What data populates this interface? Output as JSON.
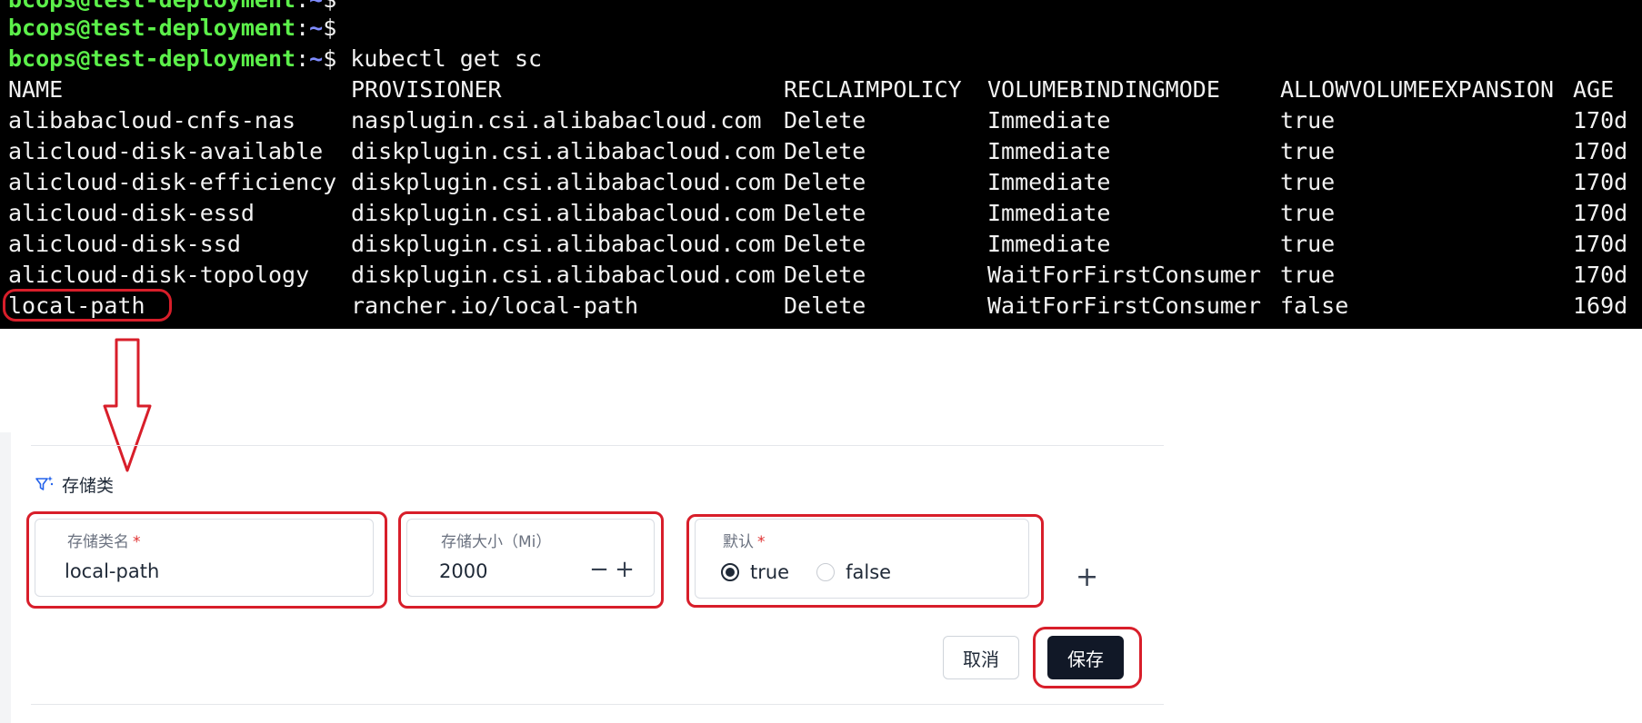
{
  "terminal": {
    "prompt": {
      "user_host": "bcops@test-deployment",
      "path": "~",
      "dollar": "$"
    },
    "command": "kubectl get sc",
    "headers": [
      "NAME",
      "PROVISIONER",
      "RECLAIMPOLICY",
      "VOLUMEBINDINGMODE",
      "ALLOWVOLUMEEXPANSION",
      "AGE"
    ],
    "rows": [
      [
        "alibabacloud-cnfs-nas",
        "nasplugin.csi.alibabacloud.com",
        "Delete",
        "Immediate",
        "true",
        "170d"
      ],
      [
        "alicloud-disk-available",
        "diskplugin.csi.alibabacloud.com",
        "Delete",
        "Immediate",
        "true",
        "170d"
      ],
      [
        "alicloud-disk-efficiency",
        "diskplugin.csi.alibabacloud.com",
        "Delete",
        "Immediate",
        "true",
        "170d"
      ],
      [
        "alicloud-disk-essd",
        "diskplugin.csi.alibabacloud.com",
        "Delete",
        "Immediate",
        "true",
        "170d"
      ],
      [
        "alicloud-disk-ssd",
        "diskplugin.csi.alibabacloud.com",
        "Delete",
        "Immediate",
        "true",
        "170d"
      ],
      [
        "alicloud-disk-topology",
        "diskplugin.csi.alibabacloud.com",
        "Delete",
        "WaitForFirstConsumer",
        "true",
        "170d"
      ],
      [
        "local-path",
        "rancher.io/local-path",
        "Delete",
        "WaitForFirstConsumer",
        "false",
        "169d"
      ]
    ]
  },
  "form": {
    "section_title": "存储类",
    "section_icon": "sparkle-filter-icon",
    "storage_class": {
      "label": "存储类名",
      "required_mark": "*",
      "value": "local-path"
    },
    "storage_size": {
      "label": "存储大小（Mi）",
      "value": "2000",
      "minus": "−",
      "plus": "+"
    },
    "default": {
      "label": "默认",
      "required_mark": "*",
      "options": [
        {
          "label": "true",
          "checked": true
        },
        {
          "label": "false",
          "checked": false
        }
      ]
    },
    "add_symbol": "+",
    "cancel_label": "取消",
    "save_label": "保存"
  },
  "colors": {
    "terminal_bg": "#000000",
    "prompt_user": "#5cf04a",
    "prompt_path": "#7f8cff",
    "annotation_red": "#d81e2a",
    "save_button_bg": "#111827",
    "required_red": "#e03131"
  }
}
